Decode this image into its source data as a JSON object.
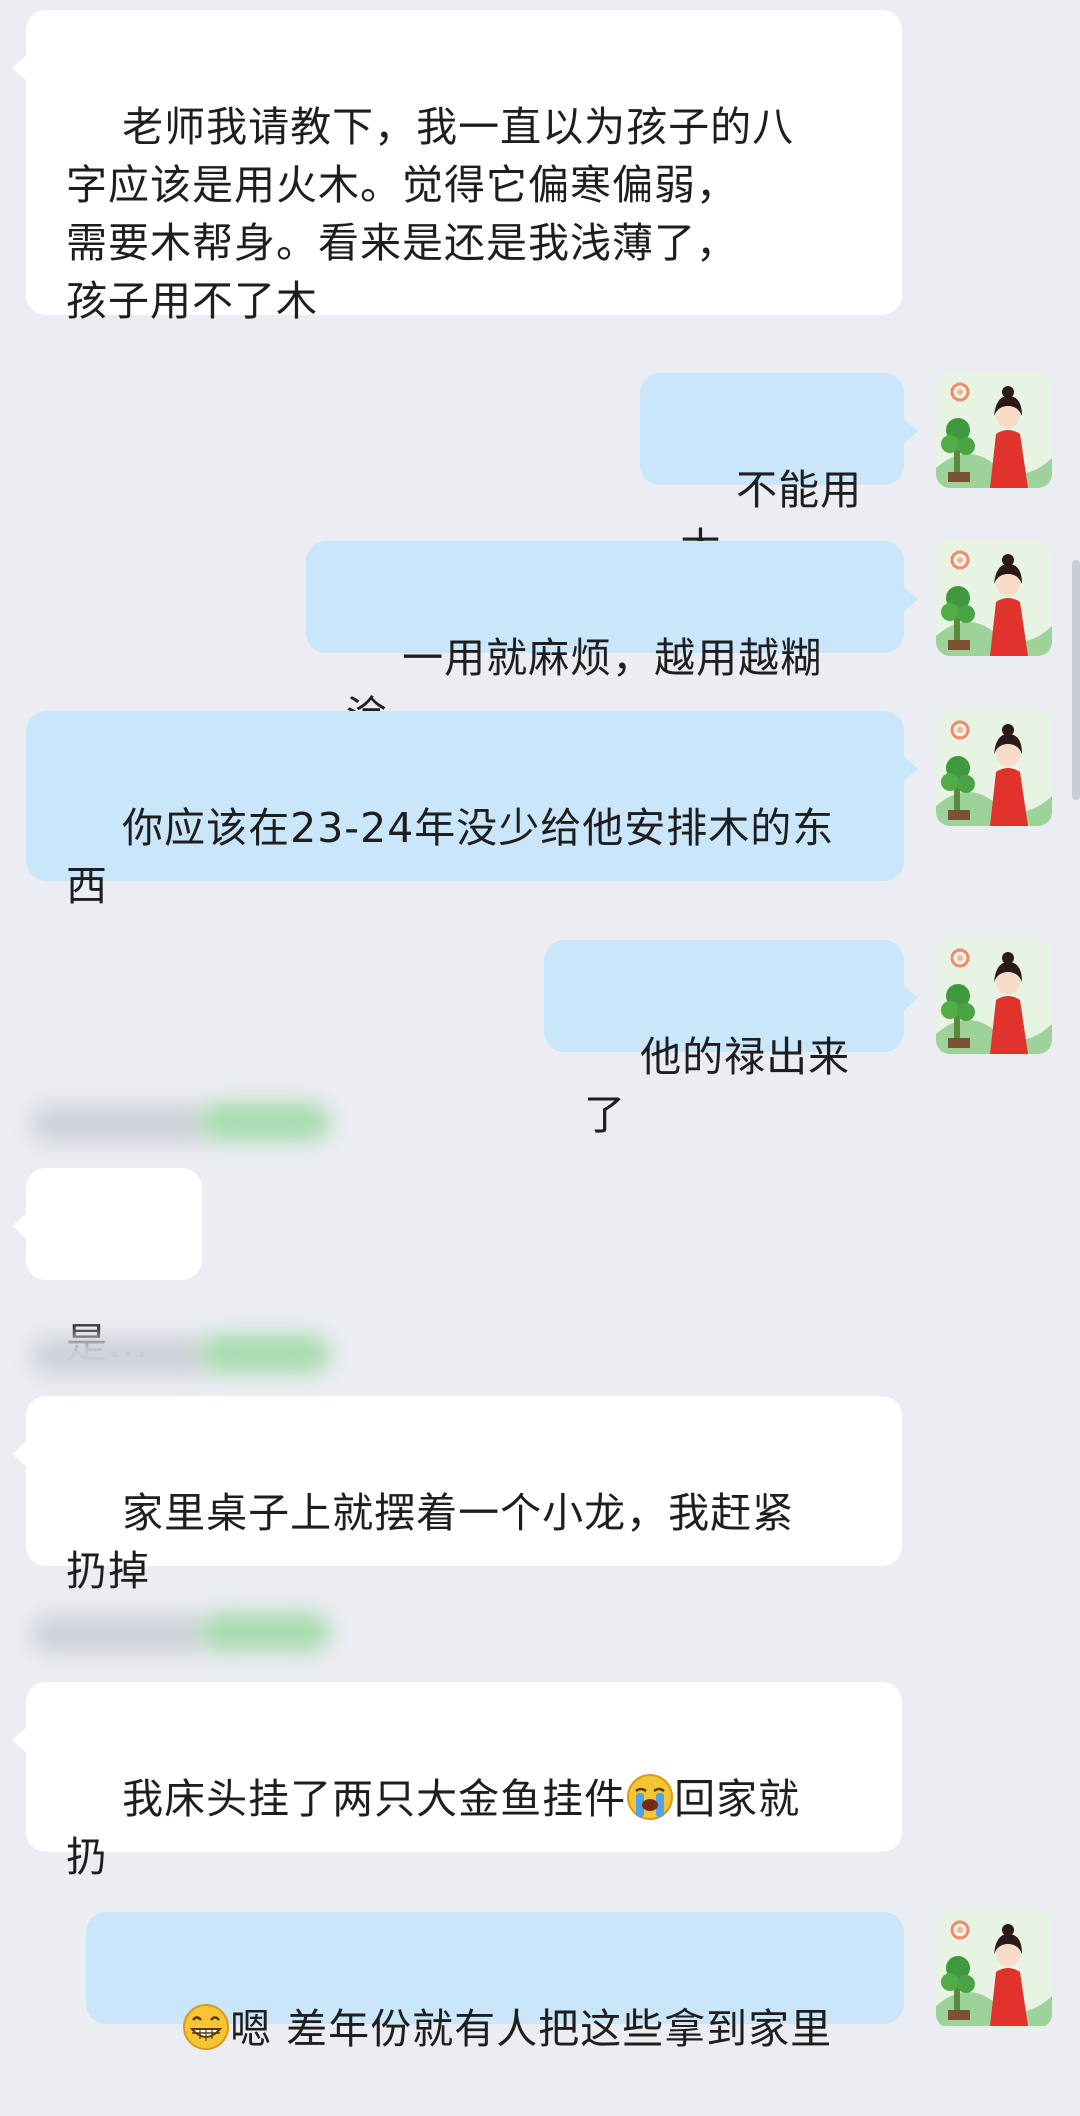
{
  "messages": [
    {
      "side": "in",
      "text": "老师我请教下，我一直以为孩子的八\n字应该是用火木。觉得它偏寒偏弱，\n需要木帮身。看来是还是我浅薄了，\n孩子用不了木"
    },
    {
      "side": "out",
      "text": "不能用木"
    },
    {
      "side": "out",
      "text": "一用就麻烦，越用越糊涂"
    },
    {
      "side": "out",
      "text": "你应该在23-24年没少给他安排木的东\n西"
    },
    {
      "side": "out",
      "text": "他的禄出来了"
    },
    {
      "side": "in",
      "text": "是…"
    },
    {
      "side": "in",
      "text": "家里桌子上就摆着一个小龙，我赶紧\n扔掉"
    },
    {
      "side": "in",
      "text_before": "我床头挂了两只大金鱼挂件",
      "emoji": "crying-face-emoji",
      "text_after": "回家就\n扔"
    },
    {
      "side": "out",
      "emoji": "grinning-face-emoji",
      "text_after": "嗯 差年份就有人把这些拿到家里"
    }
  ],
  "colors": {
    "background": "#ebedf2",
    "incoming_bubble": "#ffffff",
    "outgoing_bubble": "#c9e6fb",
    "text": "#1e1e1e",
    "blurred_name": "#9edba8"
  },
  "icons": {
    "avatar": "avatar-woman-in-red-hanfu-with-bamboo"
  }
}
